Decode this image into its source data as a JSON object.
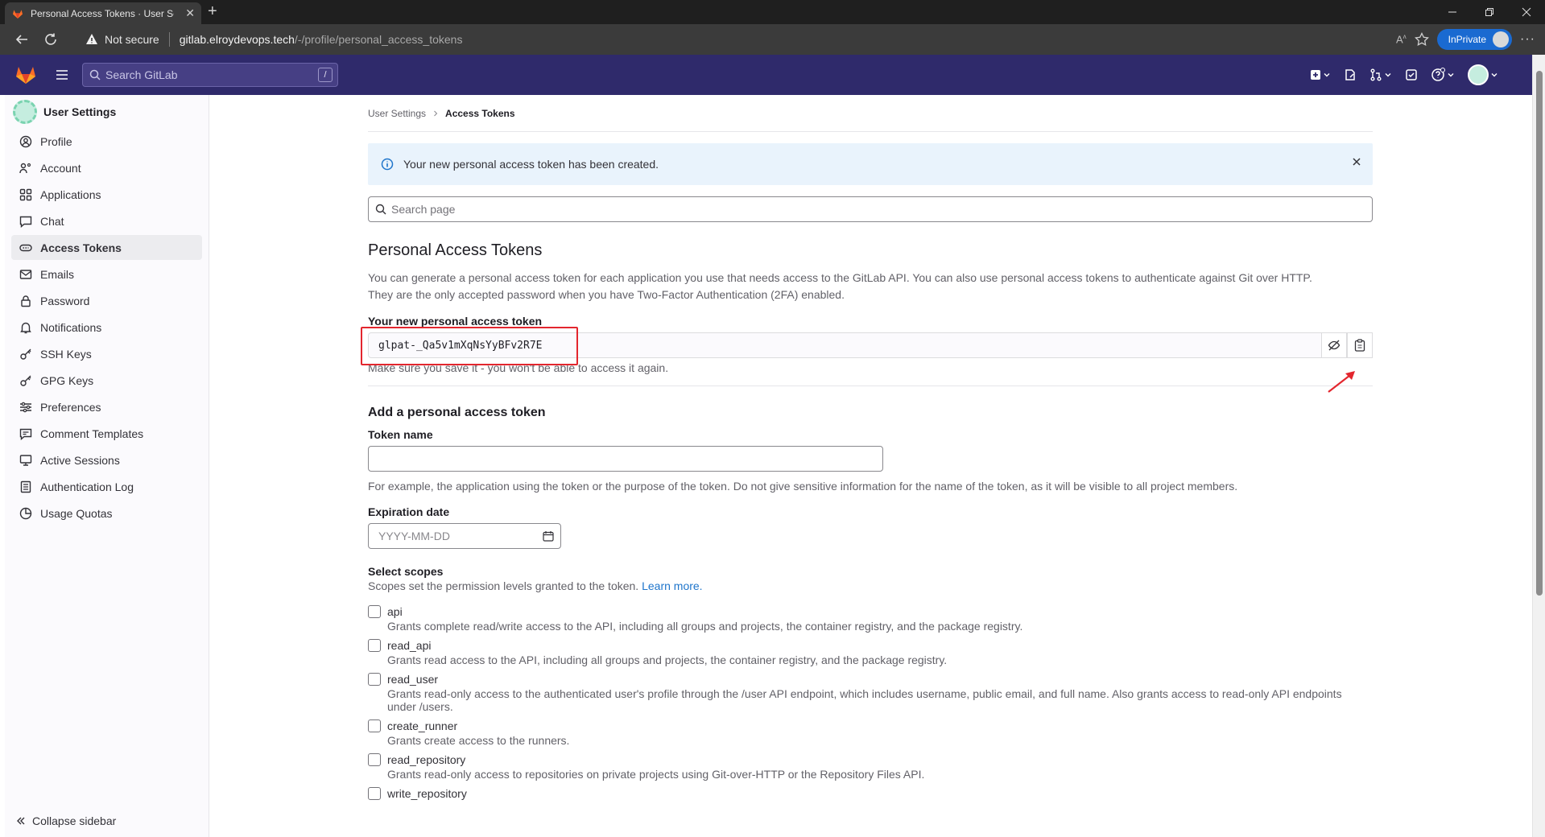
{
  "browser": {
    "tab_title": "Personal Access Tokens · User Se",
    "not_secure": "Not secure",
    "url_host": "gitlab.elroydevops.tech",
    "url_path": "/-/profile/personal_access_tokens",
    "inprivate_label": "InPrivate"
  },
  "topnav": {
    "search_placeholder": "Search GitLab",
    "search_shortcut": "/"
  },
  "sidebar": {
    "title": "User Settings",
    "items": [
      {
        "label": "Profile",
        "icon": "profile-icon"
      },
      {
        "label": "Account",
        "icon": "account-icon"
      },
      {
        "label": "Applications",
        "icon": "applications-icon"
      },
      {
        "label": "Chat",
        "icon": "chat-icon"
      },
      {
        "label": "Access Tokens",
        "icon": "token-icon",
        "active": true
      },
      {
        "label": "Emails",
        "icon": "mail-icon"
      },
      {
        "label": "Password",
        "icon": "lock-icon"
      },
      {
        "label": "Notifications",
        "icon": "bell-icon"
      },
      {
        "label": "SSH Keys",
        "icon": "key-icon"
      },
      {
        "label": "GPG Keys",
        "icon": "key-icon"
      },
      {
        "label": "Preferences",
        "icon": "preferences-icon"
      },
      {
        "label": "Comment Templates",
        "icon": "comment-icon"
      },
      {
        "label": "Active Sessions",
        "icon": "monitor-icon"
      },
      {
        "label": "Authentication Log",
        "icon": "log-icon"
      },
      {
        "label": "Usage Quotas",
        "icon": "quota-icon"
      }
    ],
    "collapse_label": "Collapse sidebar"
  },
  "main": {
    "breadcrumb": [
      "User Settings",
      "Access Tokens"
    ],
    "alert_text": "Your new personal access token has been created.",
    "search_placeholder": "Search page",
    "section_title": "Personal Access Tokens",
    "section_desc_1": "You can generate a personal access token for each application you use that needs access to the GitLab API. You can also use personal access tokens to authenticate against Git over HTTP.",
    "section_desc_2": "They are the only accepted password when you have Two-Factor Authentication (2FA) enabled.",
    "new_token_label": "Your new personal access token",
    "new_token_value": "glpat-_Qa5v1mXqNsYyBFv2R7E",
    "new_token_hint": "Make sure you save it - you won't be able to access it again.",
    "add_title": "Add a personal access token",
    "token_name_label": "Token name",
    "token_name_value": "",
    "token_name_hint": "For example, the application using the token or the purpose of the token. Do not give sensitive information for the name of the token, as it will be visible to all project members.",
    "expiration_label": "Expiration date",
    "expiration_placeholder": "YYYY-MM-DD",
    "scopes_label": "Select scopes",
    "scopes_hint": "Scopes set the permission levels granted to the token.",
    "scopes_link": "Learn more.",
    "scopes": [
      {
        "name": "api",
        "desc": "Grants complete read/write access to the API, including all groups and projects, the container registry, and the package registry."
      },
      {
        "name": "read_api",
        "desc": "Grants read access to the API, including all groups and projects, the container registry, and the package registry."
      },
      {
        "name": "read_user",
        "desc": "Grants read-only access to the authenticated user's profile through the /user API endpoint, which includes username, public email, and full name. Also grants access to read-only API endpoints under /users."
      },
      {
        "name": "create_runner",
        "desc": "Grants create access to the runners."
      },
      {
        "name": "read_repository",
        "desc": "Grants read-only access to repositories on private projects using Git-over-HTTP or the Repository Files API."
      },
      {
        "name": "write_repository",
        "desc": ""
      }
    ]
  },
  "colors": {
    "gitlab_nav": "#2f2a6b",
    "highlight_red": "#e3262e",
    "link_blue": "#1f75cb",
    "alert_bg": "#e9f3fc"
  }
}
